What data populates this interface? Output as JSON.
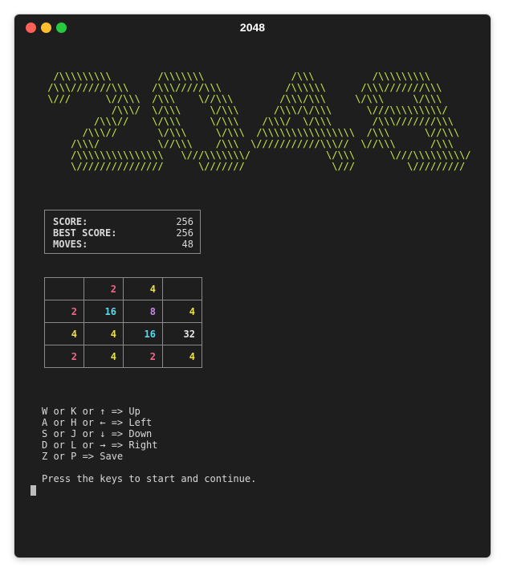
{
  "window": {
    "title": "2048"
  },
  "banner": {
    "art": "  /\\\\\\\\\\\\\\\\\\        /\\\\\\\\\\\\\\               /\\\\\\          /\\\\\\\\\\\\\\\\\\\n /\\\\\\///////\\\\\\    /\\\\\\/////\\\\\\           /\\\\\\\\\\\\      /\\\\\\///////\\\\\\\n \\///      \\//\\\\\\  /\\\\\\    \\//\\\\\\        /\\\\\\/\\\\\\     \\/\\\\\\     \\/\\\\\\\n            /\\\\\\/  \\/\\\\\\     \\/\\\\\\      /\\\\\\/\\/\\\\\\      \\///\\\\\\\\\\\\\\\\\\/\n         /\\\\\\//    \\/\\\\\\     \\/\\\\\\    /\\\\\\/  \\/\\\\\\       /\\\\\\///////\\\\\\\n       /\\\\\\//       \\/\\\\\\     \\/\\\\\\  /\\\\\\\\\\\\\\\\\\\\\\\\\\\\\\\\  /\\\\\\      \\//\\\\\\\n     /\\\\\\/          \\//\\\\\\    /\\\\\\  \\///////////\\\\\\//  \\//\\\\\\      /\\\\\\\n     /\\\\\\\\\\\\\\\\\\\\\\\\\\\\\\   \\///\\\\\\\\\\\\\\/             \\/\\\\\\      \\///\\\\\\\\\\\\\\\\\\/\n     \\///////////////      \\///////               \\///         \\/////////"
  },
  "score": {
    "score_label": "SCORE:",
    "score_value": "256",
    "best_label": "BEST SCORE:",
    "best_value": "256",
    "moves_label": "MOVES:",
    "moves_value": "48"
  },
  "board": {
    "rows": [
      [
        "",
        "2",
        "4",
        ""
      ],
      [
        "2",
        "16",
        "8",
        "4"
      ],
      [
        "4",
        "4",
        "16",
        "32"
      ],
      [
        "2",
        "4",
        "2",
        "4"
      ]
    ]
  },
  "tile_colors": {
    "2": "#f0668a",
    "4": "#e8e14a",
    "8": "#c48be0",
    "16": "#5ad9ee",
    "32": "#e6e6e6"
  },
  "help": {
    "lines": [
      "W or K or ↑ => Up",
      "A or H or ← => Left",
      "S or J or ↓ => Down",
      "D or L or → => Right",
      "Z or P => Save"
    ],
    "prompt": "Press the keys to start and continue."
  },
  "colors": {
    "background": "#1e1e1e",
    "banner": "#c6ec45",
    "text": "#d8d8d8"
  }
}
